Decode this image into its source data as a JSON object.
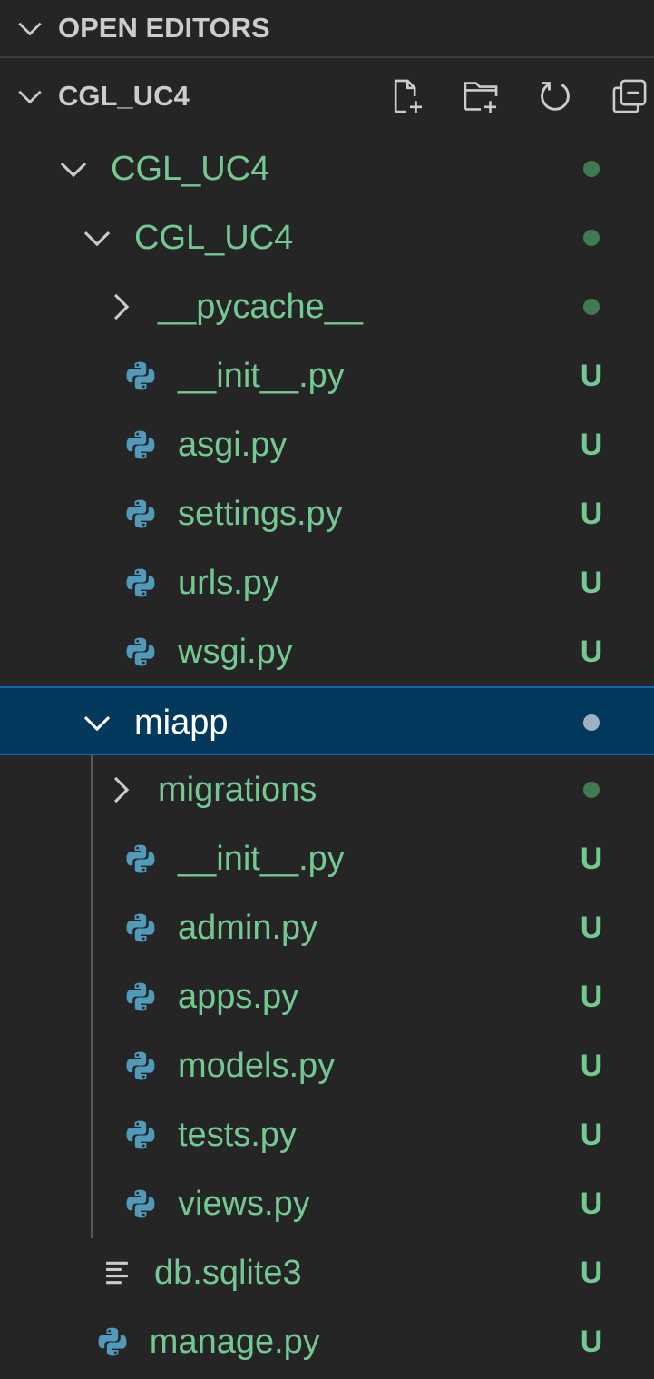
{
  "open_editors": {
    "title": "OPEN EDITORS"
  },
  "workspace": {
    "title": "CGL_UC4",
    "actions": [
      "new-file-icon",
      "new-folder-icon",
      "refresh-icon",
      "collapse-all-icon"
    ]
  },
  "colors": {
    "background": "#252526",
    "untracked_text": "#73c991",
    "selected_background": "#04395e",
    "selected_border": "#0a6cad"
  },
  "tree": [
    {
      "label": "CGL_UC4",
      "type": "folder",
      "expanded": true,
      "depth": 0,
      "decoration": "dot"
    },
    {
      "label": "CGL_UC4",
      "type": "folder",
      "expanded": true,
      "depth": 1,
      "decoration": "dot"
    },
    {
      "label": "__pycache__",
      "type": "folder",
      "expanded": false,
      "depth": 2,
      "decoration": "dot"
    },
    {
      "label": "__init__.py",
      "type": "python",
      "depth": 2,
      "decoration": "U"
    },
    {
      "label": "asgi.py",
      "type": "python",
      "depth": 2,
      "decoration": "U"
    },
    {
      "label": "settings.py",
      "type": "python",
      "depth": 2,
      "decoration": "U"
    },
    {
      "label": "urls.py",
      "type": "python",
      "depth": 2,
      "decoration": "U"
    },
    {
      "label": "wsgi.py",
      "type": "python",
      "depth": 2,
      "decoration": "U"
    },
    {
      "label": "miapp",
      "type": "folder",
      "expanded": true,
      "depth": 1,
      "decoration": "dot",
      "selected": true
    },
    {
      "label": "migrations",
      "type": "folder",
      "expanded": false,
      "depth": 2,
      "decoration": "dot"
    },
    {
      "label": "__init__.py",
      "type": "python",
      "depth": 2,
      "decoration": "U"
    },
    {
      "label": "admin.py",
      "type": "python",
      "depth": 2,
      "decoration": "U"
    },
    {
      "label": "apps.py",
      "type": "python",
      "depth": 2,
      "decoration": "U"
    },
    {
      "label": "models.py",
      "type": "python",
      "depth": 2,
      "decoration": "U"
    },
    {
      "label": "tests.py",
      "type": "python",
      "depth": 2,
      "decoration": "U"
    },
    {
      "label": "views.py",
      "type": "python",
      "depth": 2,
      "decoration": "U"
    },
    {
      "label": "db.sqlite3",
      "type": "text",
      "depth": 1,
      "decoration": "U"
    },
    {
      "label": "manage.py",
      "type": "python",
      "depth": 0.8,
      "decoration": "U"
    }
  ]
}
